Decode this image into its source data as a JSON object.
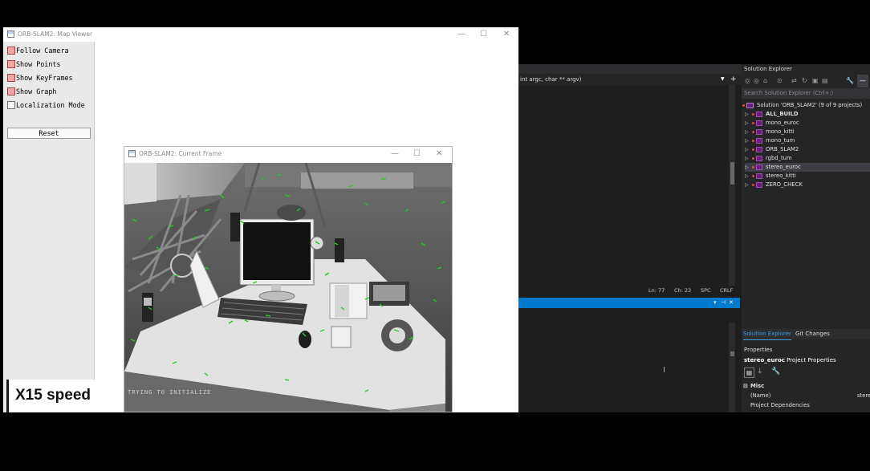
{
  "map_viewer": {
    "title": "ORB-SLAM2: Map Viewer",
    "controls": {
      "minimize": "—",
      "maximize": "☐",
      "close": "✕"
    },
    "panel": {
      "options": [
        {
          "label": "Follow Camera",
          "checked": true
        },
        {
          "label": "Show Points",
          "checked": true
        },
        {
          "label": "Show KeyFrames",
          "checked": true
        },
        {
          "label": "Show Graph",
          "checked": true
        },
        {
          "label": "Localization Mode",
          "checked": false
        }
      ],
      "reset_label": "Reset"
    },
    "overlay": {
      "speed": "X15 speed"
    }
  },
  "current_frame": {
    "title": "ORB-SLAM2: Current Frame",
    "controls": {
      "minimize": "—",
      "maximize": "☐",
      "close": "✕"
    },
    "status_text": "TRYING TO INITIALIZE"
  },
  "visual_studio": {
    "editor": {
      "signature_text": "int argc, char ** argv)"
    },
    "status": {
      "line": "Ln: 77",
      "col": "Ch: 23",
      "ws": "SPC",
      "eol": "CRLF"
    },
    "solution_explorer": {
      "title": "Solution Explorer",
      "search_placeholder": "Search Solution Explorer (Ctrl+;)",
      "solution_label": "Solution 'ORB_SLAM2' (9 of 9 projects)",
      "projects": [
        {
          "name": "ALL_BUILD",
          "bold": true,
          "selected": false
        },
        {
          "name": "mono_euroc",
          "bold": false,
          "selected": false
        },
        {
          "name": "mono_kitti",
          "bold": false,
          "selected": false
        },
        {
          "name": "mono_tum",
          "bold": false,
          "selected": false
        },
        {
          "name": "ORB_SLAM2",
          "bold": false,
          "selected": false
        },
        {
          "name": "rgbd_tum",
          "bold": false,
          "selected": false
        },
        {
          "name": "stereo_euroc",
          "bold": false,
          "selected": true
        },
        {
          "name": "stereo_kitti",
          "bold": false,
          "selected": false
        },
        {
          "name": "ZERO_CHECK",
          "bold": false,
          "selected": false
        }
      ],
      "tabs": [
        "Solution Explorer",
        "Git Changes"
      ]
    },
    "properties": {
      "title": "Properties",
      "object_name": "stereo_euroc",
      "object_type": "Project Properties",
      "section": "Misc",
      "rows": [
        {
          "label": "(Name)",
          "value": "stere"
        },
        {
          "label": "Project Dependencies",
          "value": ""
        }
      ]
    },
    "colors": {
      "accent": "#007acc",
      "editor_bg": "#1e1e1e",
      "panel_bg": "#252526"
    }
  },
  "colors": {
    "checkbox_checked": "#f4a6a6",
    "feature_points": "#22cc22"
  }
}
